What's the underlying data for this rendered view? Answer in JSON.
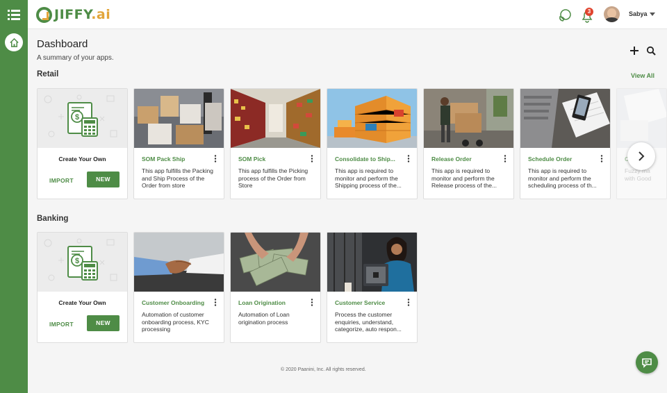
{
  "brand": {
    "name": "JIFFY",
    "suffix": ".ai"
  },
  "header": {
    "notification_count": "3",
    "user_name": "Sabya"
  },
  "page": {
    "title": "Dashboard",
    "subtitle": "A summary of your apps."
  },
  "sections": {
    "retail": {
      "title": "Retail",
      "view_all": "View All",
      "create": {
        "label": "Create Your Own",
        "import": "IMPORT",
        "new": "NEW"
      },
      "apps": [
        {
          "name": "SOM Pack Ship",
          "desc": "This app fulfills the Packing and Ship Process of the Order from store"
        },
        {
          "name": "SOM Pick",
          "desc": "This app fulfills the Picking process of the Order from Store"
        },
        {
          "name": "Consolidate to Ship...",
          "desc": "This app is required to monitor and perform the Shipping process of the..."
        },
        {
          "name": "Release Order",
          "desc": "This app is required to monitor and perform the Release process of the..."
        },
        {
          "name": "Schedule Order",
          "desc": "This app is required to monitor and perform the scheduling process of th..."
        },
        {
          "name": "C",
          "desc": "Fuzzy ma with Good"
        }
      ]
    },
    "banking": {
      "title": "Banking",
      "create": {
        "label": "Create Your Own",
        "import": "IMPORT",
        "new": "NEW"
      },
      "apps": [
        {
          "name": "Customer Onboarding",
          "desc": "Automation of customer onboarding process, KYC processing"
        },
        {
          "name": "Loan Origination",
          "desc": "Automation of Loan origination process"
        },
        {
          "name": "Customer Service",
          "desc": "Process the customer enquiries, understand, categorize, auto respon..."
        }
      ]
    }
  },
  "footer": "© 2020 Paanini, Inc. All rights reserved.",
  "colors": {
    "brand_green": "#4e8c46",
    "accent_orange": "#e2a53a",
    "badge_red": "#e0452f"
  },
  "icons": [
    "menu-icon",
    "home-icon",
    "support-phone-icon",
    "bell-icon",
    "plus-icon",
    "search-icon",
    "kebab-icon",
    "chevron-right-icon",
    "chat-icon",
    "calculator-document-icon"
  ]
}
